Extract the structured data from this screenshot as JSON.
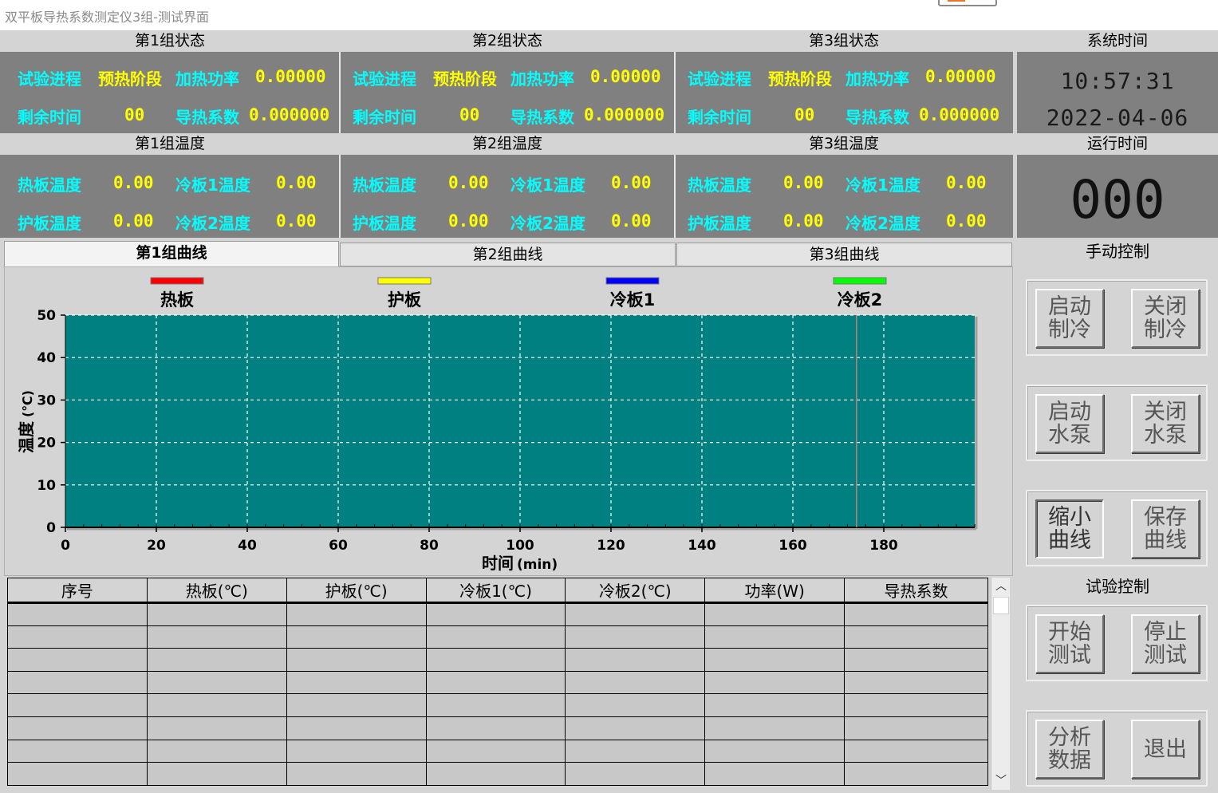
{
  "window": {
    "title": "双平板导热系数测定仪3组-测试界面"
  },
  "groups": [
    {
      "status_header": "第1组状态",
      "temp_header": "第1组温度",
      "status": {
        "progress_label": "试验进程",
        "progress_value": "预热阶段",
        "power_label": "加热功率",
        "power_value": "0.00000",
        "remaining_label": "剩余时间",
        "remaining_value": "00",
        "conductivity_label": "导热系数",
        "conductivity_value": "0.000000"
      },
      "temps": {
        "hot_label": "热板温度",
        "hot_value": "0.00",
        "cold1_label": "冷板1温度",
        "cold1_value": "0.00",
        "guard_label": "护板温度",
        "guard_value": "0.00",
        "cold2_label": "冷板2温度",
        "cold2_value": "0.00"
      }
    },
    {
      "status_header": "第2组状态",
      "temp_header": "第2组温度",
      "status": {
        "progress_label": "试验进程",
        "progress_value": "预热阶段",
        "power_label": "加热功率",
        "power_value": "0.00000",
        "remaining_label": "剩余时间",
        "remaining_value": "00",
        "conductivity_label": "导热系数",
        "conductivity_value": "0.000000"
      },
      "temps": {
        "hot_label": "热板温度",
        "hot_value": "0.00",
        "cold1_label": "冷板1温度",
        "cold1_value": "0.00",
        "guard_label": "护板温度",
        "guard_value": "0.00",
        "cold2_label": "冷板2温度",
        "cold2_value": "0.00"
      }
    },
    {
      "status_header": "第3组状态",
      "temp_header": "第3组温度",
      "status": {
        "progress_label": "试验进程",
        "progress_value": "预热阶段",
        "power_label": "加热功率",
        "power_value": "0.00000",
        "remaining_label": "剩余时间",
        "remaining_value": "00",
        "conductivity_label": "导热系数",
        "conductivity_value": "0.000000"
      },
      "temps": {
        "hot_label": "热板温度",
        "hot_value": "0.00",
        "cold1_label": "冷板1温度",
        "cold1_value": "0.00",
        "guard_label": "护板温度",
        "guard_value": "0.00",
        "cold2_label": "冷板2温度",
        "cold2_value": "0.00"
      }
    }
  ],
  "system_time": {
    "header": "系统时间",
    "time": "10:57:31",
    "date": "2022-04-06"
  },
  "run_time": {
    "header": "运行时间",
    "value": "000"
  },
  "tabs": [
    {
      "label": "第1组曲线",
      "active": true
    },
    {
      "label": "第2组曲线",
      "active": false
    },
    {
      "label": "第3组曲线",
      "active": false
    }
  ],
  "chart_data": {
    "type": "line",
    "xlabel": "时间",
    "xlabel_unit": "(min)",
    "ylabel": "温度",
    "ylabel_unit": "(℃)",
    "xlim": [
      0,
      200
    ],
    "ylim": [
      0,
      50
    ],
    "x_ticks": [
      0,
      20,
      40,
      60,
      80,
      100,
      120,
      140,
      160,
      180
    ],
    "y_ticks": [
      0,
      10,
      20,
      30,
      40,
      50
    ],
    "grid": true,
    "plot_background": "#008080",
    "cursor_x": 174,
    "legend_placement": "top",
    "series": [
      {
        "name": "热板",
        "color": "#ff0000",
        "values": []
      },
      {
        "name": "护板",
        "color": "#ffff00",
        "values": []
      },
      {
        "name": "冷板1",
        "color": "#0000ff",
        "values": []
      },
      {
        "name": "冷板2",
        "color": "#00ff00",
        "values": []
      }
    ]
  },
  "table": {
    "columns": [
      "序号",
      "热板(℃)",
      "护板(℃)",
      "冷板1(℃)",
      "冷板2(℃)",
      "功率(W)",
      "导热系数"
    ],
    "empty_rows": 8
  },
  "controls": {
    "manual_header": "手动控制",
    "test_header": "试验控制",
    "start_cooling": "启动制冷",
    "stop_cooling": "关闭制冷",
    "start_pump": "启动水泵",
    "stop_pump": "关闭水泵",
    "shrink_curve": "缩小曲线",
    "save_curve": "保存曲线",
    "start_test": "开始测试",
    "stop_test": "停止测试",
    "analyze_data": "分析数据",
    "exit": "退出"
  }
}
